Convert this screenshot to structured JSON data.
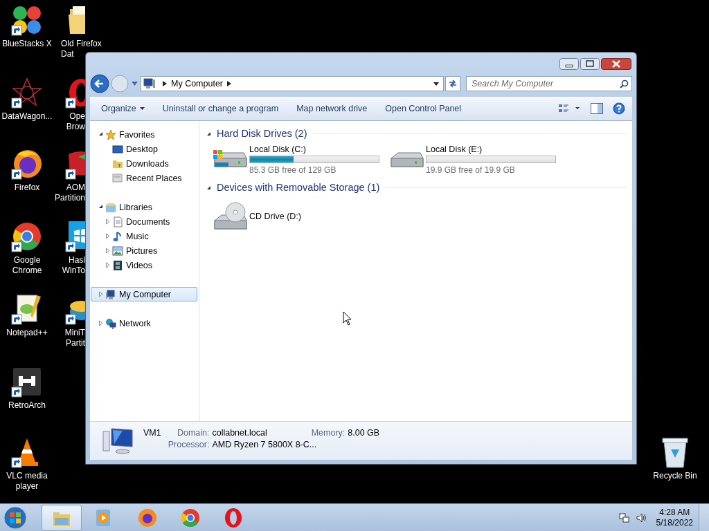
{
  "desktop_icons": [
    {
      "label": "BlueStacks X"
    },
    {
      "label": "DataWagon..."
    },
    {
      "label": "Firefox"
    },
    {
      "label": "Google\nChrome"
    },
    {
      "label": "Notepad++"
    },
    {
      "label": "RetroArch"
    },
    {
      "label": "VLC media\nplayer"
    }
  ],
  "desktop_icons_partial": [
    {
      "label": "Old Firefox\nDat"
    },
    {
      "label": "Ope\nBrow"
    },
    {
      "label": "AOM\nPartition"
    },
    {
      "label": "Hasl\nWinTo"
    },
    {
      "label": "MiniT\nPartit"
    }
  ],
  "recycle_bin": {
    "label": "Recycle Bin"
  },
  "window": {
    "address": {
      "crumb": "My Computer"
    },
    "search": {
      "placeholder": "Search My Computer"
    },
    "commands": [
      {
        "label": "Organize",
        "menu": true
      },
      {
        "label": "Uninstall or change a program",
        "menu": false
      },
      {
        "label": "Map network drive",
        "menu": false
      },
      {
        "label": "Open Control Panel",
        "menu": false
      }
    ],
    "nav": [
      {
        "label": "Favorites",
        "expanded": true,
        "selected": false,
        "children": [
          {
            "label": "Desktop",
            "selected": false
          },
          {
            "label": "Downloads",
            "selected": false
          },
          {
            "label": "Recent Places",
            "selected": false
          }
        ]
      },
      {
        "label": "Libraries",
        "expanded": true,
        "selected": false,
        "children": [
          {
            "label": "Documents",
            "expanded": false,
            "selected": false
          },
          {
            "label": "Music",
            "expanded": false,
            "selected": false
          },
          {
            "label": "Pictures",
            "expanded": false,
            "selected": false
          },
          {
            "label": "Videos",
            "expanded": false,
            "selected": false
          }
        ]
      },
      {
        "label": "My Computer",
        "expanded": false,
        "selected": true
      },
      {
        "label": "Network",
        "expanded": false,
        "selected": false
      }
    ],
    "groups": [
      {
        "title": "Hard Disk Drives (2)",
        "expanded": true,
        "items": [
          {
            "kind": "system",
            "name": "Local Disk (C:)",
            "level": 0.34,
            "free": "85.3 GB free of 129 GB"
          },
          {
            "kind": "disk",
            "name": "Local Disk (E:)",
            "level": 0,
            "free": "19.9 GB free of 19.9 GB"
          }
        ]
      },
      {
        "title": "Devices with Removable Storage (1)",
        "expanded": true,
        "items": [
          {
            "kind": "cd",
            "name": "CD Drive (D:)"
          }
        ]
      }
    ],
    "details": {
      "name": "VM1",
      "fields": [
        {
          "label": "Domain:",
          "value": "collabnet.local"
        },
        {
          "label": "Memory:",
          "value": "8.00 GB"
        },
        {
          "label": "Processor:",
          "value": "AMD Ryzen 7 5800X 8-C..."
        }
      ]
    }
  },
  "taskbar": {
    "buttons": [
      {
        "selected": true
      },
      {
        "selected": false
      },
      {
        "selected": false
      },
      {
        "selected": false
      },
      {
        "selected": false
      }
    ],
    "time": "4:28 AM",
    "date": "5/18/2022"
  }
}
